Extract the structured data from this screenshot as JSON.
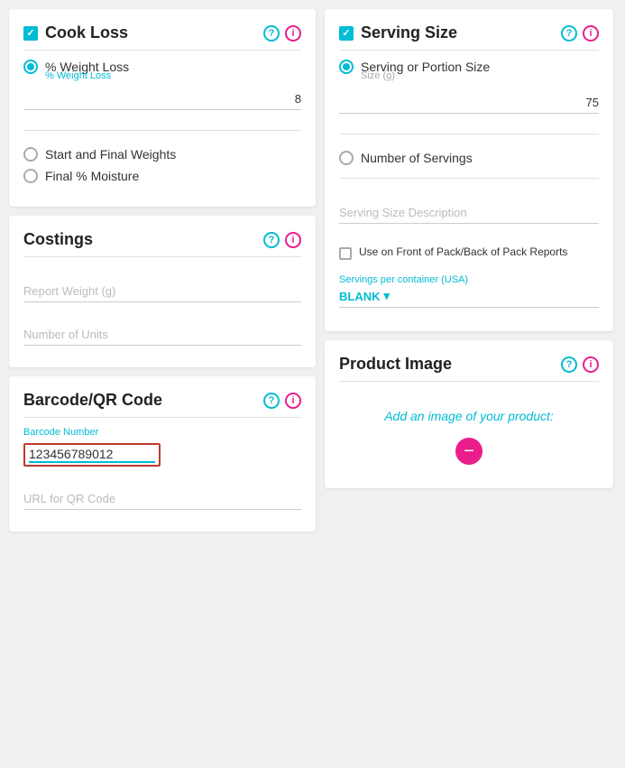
{
  "cook_loss": {
    "title": "Cook Loss",
    "help_icon": "?",
    "info_icon": "i",
    "options": [
      {
        "id": "weight_loss",
        "label": "% Weight Loss",
        "selected": true,
        "sub_label": "% Weight Loss"
      },
      {
        "id": "start_final",
        "label": "Start and Final Weights",
        "selected": false
      },
      {
        "id": "final_moisture",
        "label": "Final % Moisture",
        "selected": false
      }
    ],
    "weight_loss_value": "8"
  },
  "costings": {
    "title": "Costings",
    "help_icon": "?",
    "info_icon": "i",
    "report_weight_placeholder": "Report Weight (g)",
    "number_of_units_placeholder": "Number of Units"
  },
  "barcode": {
    "title": "Barcode/QR Code",
    "help_icon": "?",
    "info_icon": "i",
    "barcode_label": "Barcode Number",
    "barcode_value": "123456789012",
    "url_placeholder": "URL for QR Code"
  },
  "serving_size": {
    "title": "Serving Size",
    "help_icon": "?",
    "info_icon": "i",
    "options": [
      {
        "id": "serving_portion",
        "label": "Serving or Portion Size",
        "selected": true,
        "sub_label": "Size (g)"
      },
      {
        "id": "num_servings",
        "label": "Number of Servings",
        "selected": false
      }
    ],
    "serving_value": "75",
    "serving_desc_placeholder": "Serving Size Description",
    "checkbox_label": "Use on Front of Pack/Back of Pack Reports",
    "servings_container_label": "Servings per container (USA)",
    "blank_label": "BLANK",
    "chevron": "▾"
  },
  "product_image": {
    "title": "Product Image",
    "help_icon": "?",
    "info_icon": "i",
    "add_text_prefix": "Add ",
    "add_text_emphasis": "an image of your product",
    "add_text_suffix": ":"
  }
}
